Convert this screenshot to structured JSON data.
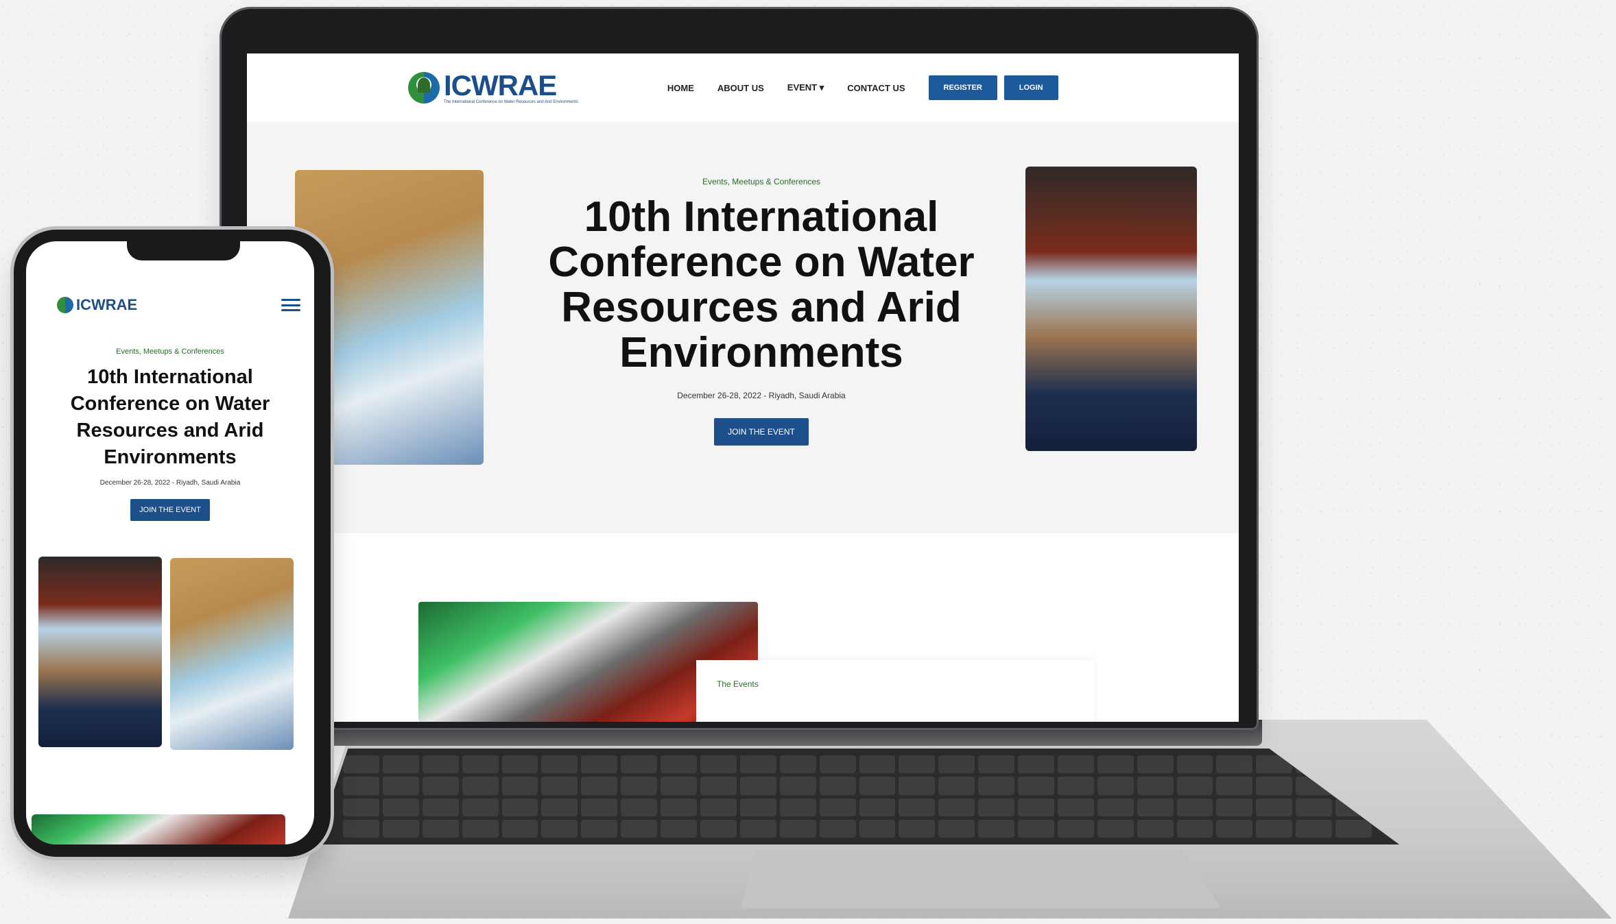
{
  "site": {
    "logo_text": "ICWRAE",
    "logo_subtitle": "The International Conference on Water Resources and Arid Environments",
    "nav": {
      "links": [
        "HOME",
        "ABOUT US",
        "EVENT ▾",
        "CONTACT US"
      ],
      "register_label": "REGISTER",
      "login_label": "LOGIN"
    },
    "hero": {
      "eyebrow": "Events, Meetups & Conferences",
      "title": "10th International Conference on Water Resources and Arid Environments",
      "date": "December 26-28, 2022 - Riyadh, Saudi Arabia",
      "cta_label": "JOIN THE EVENT"
    },
    "events_section_label": "The Events"
  },
  "mobile": {
    "logo_text": "ICWRAE",
    "eyebrow": "Events, Meetups & Conferences",
    "title": "10th International Conference on Water Resources and Arid Environments",
    "date": "December 26-28, 2022 - Riyadh, Saudi Arabia",
    "cta_label": "JOIN THE EVENT"
  },
  "colors": {
    "brand_blue": "#1c4e8b",
    "button_blue": "#1d5a9c",
    "accent_green": "#2a6a2a"
  },
  "icons": [
    "logo-icon",
    "hamburger-menu-icon",
    "chevron-down-icon"
  ]
}
